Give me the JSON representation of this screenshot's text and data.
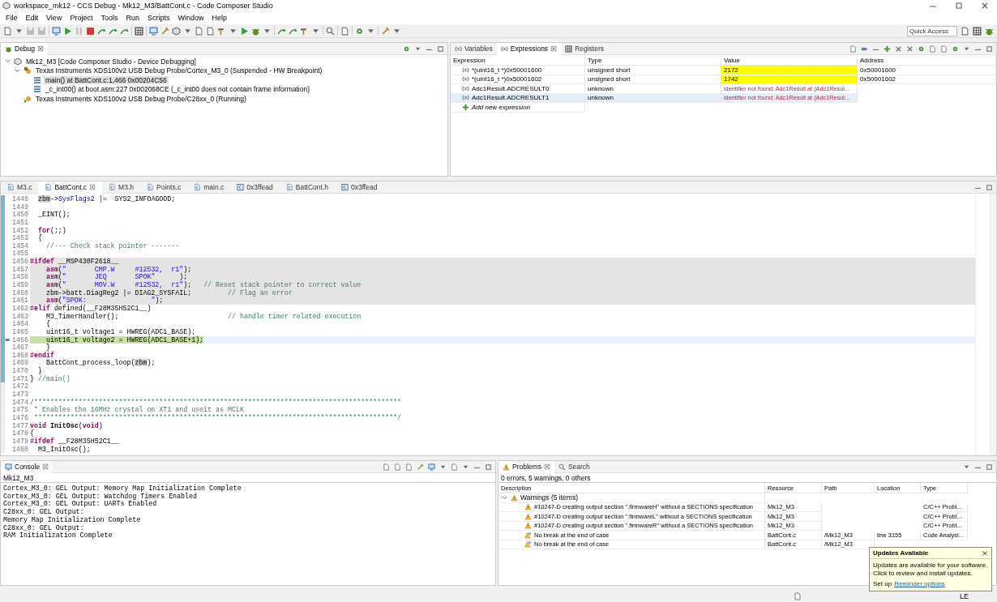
{
  "window": {
    "title": "workspace_mk12 - CCS Debug - Mk12_M3/BattCont.c - Code Composer Studio"
  },
  "menu": [
    "File",
    "Edit",
    "View",
    "Project",
    "Tools",
    "Run",
    "Scripts",
    "Window",
    "Help"
  ],
  "quick_access": {
    "placeholder": "Quick Access"
  },
  "debug": {
    "tab": {
      "label": "Debug",
      "selected": true
    },
    "tree": [
      {
        "label": "Mk12_M3 [Code Composer Studio - Device Debugging]",
        "kind": "session",
        "expanded": true,
        "selected": false,
        "children": [
          {
            "label": "Texas Instruments XDS100v2 USB Debug Probe/Cortex_M3_0 (Suspended - HW Breakpoint)",
            "kind": "core",
            "expanded": true,
            "selected": false,
            "children": [
              {
                "label": "main() at BattCont.c:1,466 0x00204C56",
                "kind": "frame",
                "selected": true
              },
              {
                "label": "_c_int00() at boot.asm:227 0x002068CE  (_c_int00 does not contain frame information)",
                "kind": "frame",
                "selected": false
              }
            ]
          },
          {
            "label": "Texas Instruments XDS100v2 USB Debug Probe/C28xx_0 (Running)",
            "kind": "core",
            "selected": false
          }
        ]
      }
    ]
  },
  "expressions": {
    "tabs": [
      {
        "label": "Variables",
        "selected": false
      },
      {
        "label": "Expressions",
        "selected": true
      },
      {
        "label": "Registers",
        "selected": false
      }
    ],
    "columns": [
      "Expression",
      "Type",
      "Value",
      "Address"
    ],
    "rows": [
      {
        "expression": "*(uint16_t *)0x50001600",
        "type": "unsigned short",
        "value": "2172",
        "address": "0x50001600",
        "changed": true,
        "error": false,
        "selected": false
      },
      {
        "expression": "*(uint16_t *)0x50001602",
        "type": "unsigned short",
        "value": "1742",
        "address": "0x50001602",
        "changed": true,
        "error": false,
        "selected": false
      },
      {
        "expression": "Adc1Result.ADCRESULT0",
        "type": "unknown",
        "value": "identifier not found: Adc1Result at (Adc1Resul...",
        "changed": false,
        "error": true,
        "selected": false
      },
      {
        "expression": "Adc1Result.ADCRESULT1",
        "type": "unknown",
        "value": "identifier not found: Adc1Result at (Adc1Resul...",
        "changed": false,
        "error": true,
        "selected": true
      }
    ],
    "add_row": "Add new expression"
  },
  "editor": {
    "tabs": [
      {
        "label": "M3.c",
        "kind": "file",
        "selected": false
      },
      {
        "label": "BattCont.c",
        "kind": "file",
        "selected": true
      },
      {
        "label": "M3.h",
        "kind": "file",
        "selected": false
      },
      {
        "label": "Points.c",
        "kind": "file",
        "selected": false
      },
      {
        "label": "main.c",
        "kind": "file",
        "selected": false
      },
      {
        "label": "0x3ffead",
        "kind": "memory",
        "selected": false
      },
      {
        "label": "BattCont.h",
        "kind": "file",
        "selected": false
      },
      {
        "label": "0x3ffead",
        "kind": "memory",
        "selected": false
      }
    ],
    "lines": [
      {
        "number": "1448",
        "in_scope": true,
        "inactive": false,
        "current": false,
        "parts": [
          {
            "text": "  zbm",
            "kind": "occurrence"
          },
          {
            "text": "->",
            "kind": "plain"
          },
          {
            "text": "SysFlags2",
            "kind": "field"
          },
          {
            "text": " |=  SYS2_INFOAGOOD;",
            "kind": "plain"
          }
        ]
      },
      {
        "number": "1449",
        "in_scope": true,
        "inactive": false,
        "current": false
      },
      {
        "number": "1450",
        "in_scope": true,
        "inactive": false,
        "current": false,
        "parts": [
          {
            "text": "  _EINT();",
            "kind": "plain"
          }
        ]
      },
      {
        "number": "1451",
        "in_scope": true,
        "inactive": false,
        "current": false
      },
      {
        "number": "1452",
        "in_scope": true,
        "inactive": false,
        "current": false,
        "parts": [
          {
            "text": "  for",
            "kind": "keyword"
          },
          {
            "text": "(;;)",
            "kind": "plain"
          }
        ]
      },
      {
        "number": "1453",
        "in_scope": true,
        "inactive": false,
        "current": false,
        "parts": [
          {
            "text": "  {",
            "kind": "plain"
          }
        ]
      },
      {
        "number": "1454",
        "in_scope": true,
        "inactive": false,
        "current": false,
        "parts": [
          {
            "text": "    //--- Check stack pointer -------",
            "kind": "comment"
          }
        ]
      },
      {
        "number": "1455",
        "in_scope": true,
        "inactive": false,
        "current": false
      },
      {
        "number": "1456",
        "in_scope": true,
        "inactive": true,
        "current": false,
        "parts": [
          {
            "text": "#ifdef",
            "kind": "keyword"
          },
          {
            "text": " __MSP430F2618__",
            "kind": "plain"
          }
        ]
      },
      {
        "number": "1457",
        "in_scope": true,
        "inactive": true,
        "current": false,
        "parts": [
          {
            "text": "    asm",
            "kind": "keyword"
          },
          {
            "text": "(",
            "kind": "plain"
          },
          {
            "text": "\"       CMP.W     #12532,  r1\"",
            "kind": "string"
          },
          {
            "text": ");",
            "kind": "plain"
          }
        ]
      },
      {
        "number": "1458",
        "in_scope": true,
        "inactive": true,
        "current": false,
        "parts": [
          {
            "text": "    asm",
            "kind": "keyword"
          },
          {
            "text": "(",
            "kind": "plain"
          },
          {
            "text": "\"       JEQ       SPOK\"",
            "kind": "string"
          },
          {
            "text": "      );",
            "kind": "plain"
          }
        ]
      },
      {
        "number": "1459",
        "in_scope": true,
        "inactive": true,
        "current": false,
        "parts": [
          {
            "text": "    asm",
            "kind": "keyword"
          },
          {
            "text": "(",
            "kind": "plain"
          },
          {
            "text": "\"       MOV.W     #12532,  r1\"",
            "kind": "string"
          },
          {
            "text": ");   ",
            "kind": "plain"
          },
          {
            "text": "// Reset stack pointer to correct value",
            "kind": "comment"
          }
        ]
      },
      {
        "number": "1460",
        "in_scope": true,
        "inactive": true,
        "current": false,
        "parts": [
          {
            "text": "    zbm->batt.DiagReg2 |= DIAG2_SYSFAIL;         ",
            "kind": "plain"
          },
          {
            "text": "// Flag an error",
            "kind": "comment"
          }
        ]
      },
      {
        "number": "1461",
        "in_scope": true,
        "inactive": true,
        "current": false,
        "parts": [
          {
            "text": "    asm",
            "kind": "keyword"
          },
          {
            "text": "(",
            "kind": "plain"
          },
          {
            "text": "\"SPOK:                \"",
            "kind": "string"
          },
          {
            "text": ");",
            "kind": "plain"
          }
        ]
      },
      {
        "number": "1462",
        "in_scope": true,
        "inactive": false,
        "current": false,
        "parts": [
          {
            "text": "#elif",
            "kind": "keyword"
          },
          {
            "text": " defined(__F28M35H52C1__)",
            "kind": "plain"
          }
        ]
      },
      {
        "number": "1463",
        "in_scope": true,
        "inactive": false,
        "current": false,
        "parts": [
          {
            "text": "    M3_TimerHandler();                           ",
            "kind": "plain"
          },
          {
            "text": "// handle timer related execution",
            "kind": "comment"
          }
        ]
      },
      {
        "number": "1464",
        "in_scope": true,
        "inactive": false,
        "current": false,
        "parts": [
          {
            "text": "    {",
            "kind": "plain"
          }
        ]
      },
      {
        "number": "1465",
        "in_scope": true,
        "inactive": false,
        "current": false,
        "parts": [
          {
            "text": "    uint16_t voltage1 = HWREG(ADC1_BASE);",
            "kind": "plain"
          }
        ]
      },
      {
        "number": "1466",
        "in_scope": true,
        "inactive": false,
        "current": true,
        "parts": [
          {
            "text": "    uint16_t voltage2 = HWREG(ADC1_BASE+1);",
            "kind": "plain"
          }
        ]
      },
      {
        "number": "1467",
        "in_scope": true,
        "inactive": false,
        "current": false,
        "parts": [
          {
            "text": "    }",
            "kind": "plain"
          }
        ]
      },
      {
        "number": "1468",
        "in_scope": true,
        "inactive": false,
        "current": false,
        "parts": [
          {
            "text": "#endif",
            "kind": "keyword"
          }
        ]
      },
      {
        "number": "1469",
        "in_scope": true,
        "inactive": false,
        "current": false,
        "parts": [
          {
            "text": "    BattCont_process_loop(",
            "kind": "plain"
          },
          {
            "text": "zbm",
            "kind": "occurrence"
          },
          {
            "text": ");",
            "kind": "plain"
          }
        ]
      },
      {
        "number": "1470",
        "in_scope": true,
        "inactive": false,
        "current": false,
        "parts": [
          {
            "text": "  }",
            "kind": "plain"
          }
        ]
      },
      {
        "number": "1471",
        "in_scope": true,
        "inactive": false,
        "current": false,
        "parts": [
          {
            "text": "} ",
            "kind": "plain"
          },
          {
            "text": "//main()",
            "kind": "comment"
          }
        ]
      },
      {
        "number": "1472",
        "in_scope": false,
        "inactive": false,
        "current": false
      },
      {
        "number": "1473",
        "in_scope": false,
        "inactive": false,
        "current": false
      },
      {
        "number": "1474",
        "in_scope": false,
        "inactive": false,
        "current": false,
        "parts": [
          {
            "text": "/*******************************************************************************************",
            "kind": "comment"
          }
        ]
      },
      {
        "number": "1475",
        "in_scope": false,
        "inactive": false,
        "current": false,
        "parts": [
          {
            "text": " * Enables the 16MHz crystal on XT1 and useit as MCLK",
            "kind": "comment"
          }
        ]
      },
      {
        "number": "1476",
        "in_scope": false,
        "inactive": false,
        "current": false,
        "parts": [
          {
            "text": " ******************************************************************************************/",
            "kind": "comment"
          }
        ]
      },
      {
        "number": "1477",
        "in_scope": false,
        "inactive": false,
        "current": false,
        "parts": [
          {
            "text": "void",
            "kind": "keyword"
          },
          {
            "text": " InitOsc",
            "kind": "declaration"
          },
          {
            "text": "(",
            "kind": "plain"
          },
          {
            "text": "void",
            "kind": "keyword"
          },
          {
            "text": ")",
            "kind": "plain"
          }
        ]
      },
      {
        "number": "1478",
        "in_scope": false,
        "inactive": false,
        "current": false,
        "parts": [
          {
            "text": "{",
            "kind": "plain"
          }
        ]
      },
      {
        "number": "1479",
        "in_scope": false,
        "inactive": false,
        "current": false,
        "parts": [
          {
            "text": "#ifdef",
            "kind": "keyword"
          },
          {
            "text": " __F28M35H52C1__",
            "kind": "plain"
          }
        ]
      },
      {
        "number": "1480",
        "in_scope": false,
        "inactive": false,
        "current": false,
        "parts": [
          {
            "text": "  M3_InitOsc();",
            "kind": "plain"
          }
        ]
      }
    ]
  },
  "console": {
    "tab": {
      "label": "Console",
      "selected": true
    },
    "name": "Mk12_M3",
    "lines": [
      "Cortex_M3_0: GEL Output: Memory Map Initialization Complete",
      "Cortex_M3_0: GEL Output: Watchdog Timers Enabled",
      "Cortex_M3_0: GEL Output: UARTs Enabled",
      "C28xx_0: GEL Output:",
      "Memory Map Initialization Complete",
      "C28xx_0: GEL Output:",
      "RAM Initialization Complete"
    ]
  },
  "problems": {
    "tabs": [
      {
        "label": "Problems",
        "selected": true
      },
      {
        "label": "Search",
        "selected": false
      }
    ],
    "summary": "0 errors, 5 warnings, 0 others",
    "columns": [
      "Description",
      "Resource",
      "Path",
      "Location",
      "Type"
    ],
    "group": {
      "label": "Warnings (5 items)",
      "expanded": true,
      "items": [
        {
          "kind": "warning",
          "description": "#10247-D creating output section \".firmwareH\" without a SECTIONS specification",
          "resource": "Mk12_M3",
          "type": "C/C++ Probl..."
        },
        {
          "kind": "warning",
          "description": "#10247-D creating output section \".firmwareL\" without a SECTIONS specification",
          "resource": "Mk12_M3",
          "type": "C/C++ Probl..."
        },
        {
          "kind": "warning",
          "description": "#10247-D creating output section \".firmwareR\" without a SECTIONS specification",
          "resource": "Mk12_M3",
          "type": "C/C++ Probl..."
        },
        {
          "kind": "analysis",
          "description": "No break at the end of case",
          "resource": "BattCont.c",
          "path": "/Mk12_M3",
          "location": "line 3155",
          "type": "Code Analysi..."
        },
        {
          "kind": "analysis",
          "description": "No break at the end of case",
          "resource": "BattCont.c",
          "path": "/Mk12_M3"
        }
      ]
    }
  },
  "notification": {
    "title": "Updates Available",
    "lines": [
      "Updates are available for your software.",
      "Click to review and install updates."
    ],
    "footer": "Set up",
    "link": "Reminder options"
  },
  "status_bar": {
    "insert_mode": "LE"
  }
}
